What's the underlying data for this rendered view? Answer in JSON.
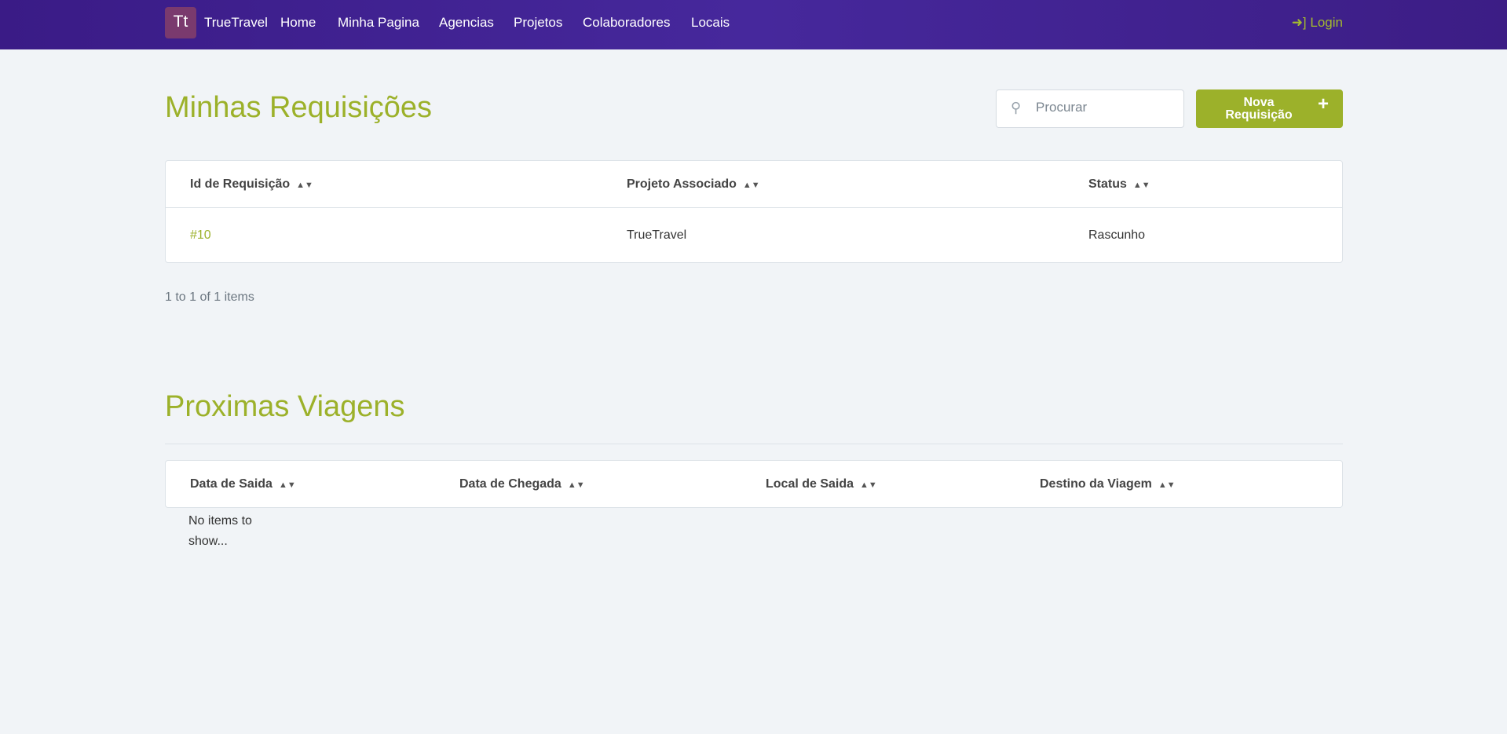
{
  "nav": {
    "logo": "Tt",
    "brand": "TrueTravel",
    "items": [
      "Home",
      "Minha Pagina",
      "Agencias",
      "Projetos",
      "Colaboradores",
      "Locais"
    ],
    "login": "Login"
  },
  "requisicoes": {
    "title": "Minhas Requisições",
    "search_placeholder": "Procurar",
    "new_button": "Nova Requisição",
    "columns": [
      "Id de Requisição",
      "Projeto Associado",
      "Status"
    ],
    "rows": [
      {
        "id": "#10",
        "projeto": "TrueTravel",
        "status": "Rascunho"
      }
    ],
    "pagination": "1 to 1 of 1 items"
  },
  "viagens": {
    "title": "Proximas Viagens",
    "columns": [
      "Data de Saida",
      "Data de Chegada",
      "Local de Saida",
      "Destino da Viagem"
    ],
    "empty": "No items to show..."
  },
  "colors": {
    "accent": "#9cb12a",
    "nav": "#3f2190"
  }
}
